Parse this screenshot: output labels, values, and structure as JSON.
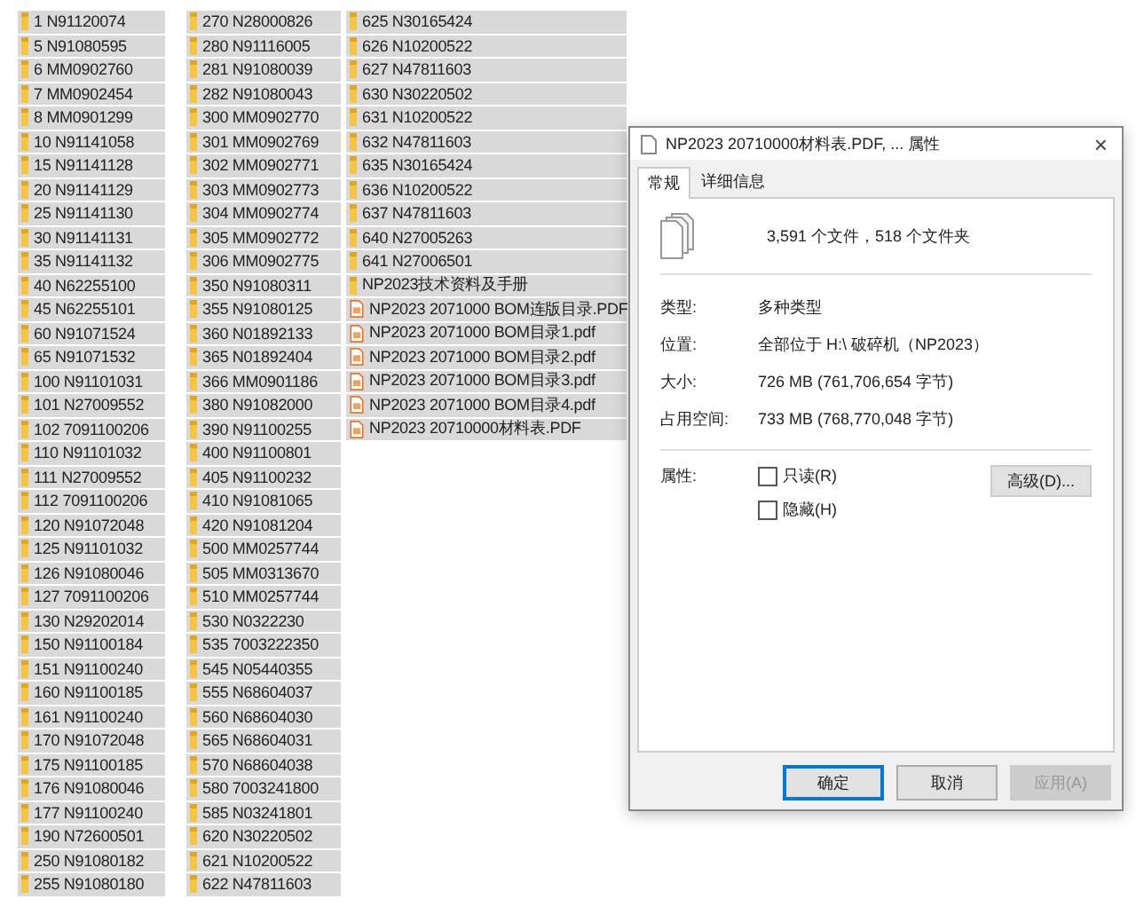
{
  "file_columns": [
    {
      "items": [
        {
          "name": "1 N91120074",
          "kind": "folder",
          "selected": true
        },
        {
          "name": "5 N91080595",
          "kind": "folder",
          "selected": true
        },
        {
          "name": "6 MM0902760",
          "kind": "folder",
          "selected": true
        },
        {
          "name": "7 MM0902454",
          "kind": "folder",
          "selected": true
        },
        {
          "name": "8 MM0901299",
          "kind": "folder",
          "selected": true
        },
        {
          "name": "10 N91141058",
          "kind": "folder",
          "selected": true
        },
        {
          "name": "15 N91141128",
          "kind": "folder",
          "selected": true
        },
        {
          "name": "20 N91141129",
          "kind": "folder",
          "selected": true
        },
        {
          "name": "25 N91141130",
          "kind": "folder",
          "selected": true
        },
        {
          "name": "30 N91141131",
          "kind": "folder",
          "selected": true
        },
        {
          "name": "35 N91141132",
          "kind": "folder",
          "selected": true
        },
        {
          "name": "40 N62255100",
          "kind": "folder",
          "selected": true
        },
        {
          "name": "45 N62255101",
          "kind": "folder",
          "selected": true
        },
        {
          "name": "60 N91071524",
          "kind": "folder",
          "selected": true
        },
        {
          "name": "65 N91071532",
          "kind": "folder",
          "selected": true
        },
        {
          "name": "100 N91101031",
          "kind": "folder",
          "selected": true
        },
        {
          "name": "101 N27009552",
          "kind": "folder",
          "selected": true
        },
        {
          "name": "102 7091100206",
          "kind": "folder",
          "selected": true
        },
        {
          "name": "110 N91101032",
          "kind": "folder",
          "selected": true
        },
        {
          "name": "111 N27009552",
          "kind": "folder",
          "selected": true
        },
        {
          "name": "112 7091100206",
          "kind": "folder",
          "selected": true
        },
        {
          "name": "120 N91072048",
          "kind": "folder",
          "selected": true
        },
        {
          "name": "125 N91101032",
          "kind": "folder",
          "selected": true
        },
        {
          "name": "126 N91080046",
          "kind": "folder",
          "selected": true
        },
        {
          "name": "127 7091100206",
          "kind": "folder",
          "selected": true
        },
        {
          "name": "130 N29202014",
          "kind": "folder",
          "selected": true
        },
        {
          "name": "150 N91100184",
          "kind": "folder",
          "selected": true
        },
        {
          "name": "151 N91100240",
          "kind": "folder",
          "selected": true
        },
        {
          "name": "160 N91100185",
          "kind": "folder",
          "selected": true
        },
        {
          "name": "161 N91100240",
          "kind": "folder",
          "selected": true
        },
        {
          "name": "170 N91072048",
          "kind": "folder",
          "selected": true
        },
        {
          "name": "175 N91100185",
          "kind": "folder",
          "selected": true
        },
        {
          "name": "176 N91080046",
          "kind": "folder",
          "selected": true
        },
        {
          "name": "177 N91100240",
          "kind": "folder",
          "selected": true
        },
        {
          "name": "190 N72600501",
          "kind": "folder",
          "selected": true
        },
        {
          "name": "250 N91080182",
          "kind": "folder",
          "selected": true
        },
        {
          "name": "255 N91080180",
          "kind": "folder",
          "selected": true
        }
      ]
    },
    {
      "items": [
        {
          "name": "270 N28000826",
          "kind": "folder",
          "selected": true
        },
        {
          "name": "280 N91116005",
          "kind": "folder",
          "selected": true
        },
        {
          "name": "281 N91080039",
          "kind": "folder",
          "selected": true
        },
        {
          "name": "282 N91080043",
          "kind": "folder",
          "selected": true
        },
        {
          "name": "300 MM0902770",
          "kind": "folder",
          "selected": true
        },
        {
          "name": "301 MM0902769",
          "kind": "folder",
          "selected": true
        },
        {
          "name": "302 MM0902771",
          "kind": "folder",
          "selected": true
        },
        {
          "name": "303 MM0902773",
          "kind": "folder",
          "selected": true
        },
        {
          "name": "304 MM0902774",
          "kind": "folder",
          "selected": true
        },
        {
          "name": "305 MM0902772",
          "kind": "folder",
          "selected": true
        },
        {
          "name": "306 MM0902775",
          "kind": "folder",
          "selected": true
        },
        {
          "name": "350 N91080311",
          "kind": "folder",
          "selected": true
        },
        {
          "name": "355 N91080125",
          "kind": "folder",
          "selected": true
        },
        {
          "name": "360 N01892133",
          "kind": "folder",
          "selected": true
        },
        {
          "name": "365 N01892404",
          "kind": "folder",
          "selected": true
        },
        {
          "name": "366 MM0901186",
          "kind": "folder",
          "selected": true
        },
        {
          "name": "380 N91082000",
          "kind": "folder",
          "selected": true
        },
        {
          "name": "390 N91100255",
          "kind": "folder",
          "selected": true
        },
        {
          "name": "400 N91100801",
          "kind": "folder",
          "selected": true
        },
        {
          "name": "405 N91100232",
          "kind": "folder",
          "selected": true
        },
        {
          "name": "410 N91081065",
          "kind": "folder",
          "selected": true
        },
        {
          "name": "420 N91081204",
          "kind": "folder",
          "selected": true
        },
        {
          "name": "500 MM0257744",
          "kind": "folder",
          "selected": true
        },
        {
          "name": "505 MM0313670",
          "kind": "folder",
          "selected": true
        },
        {
          "name": "510 MM0257744",
          "kind": "folder",
          "selected": true
        },
        {
          "name": "530 N0322230",
          "kind": "folder",
          "selected": true
        },
        {
          "name": "535 7003222350",
          "kind": "folder",
          "selected": true
        },
        {
          "name": "545 N05440355",
          "kind": "folder",
          "selected": true
        },
        {
          "name": "555 N68604037",
          "kind": "folder",
          "selected": true
        },
        {
          "name": "560 N68604030",
          "kind": "folder",
          "selected": true
        },
        {
          "name": "565 N68604031",
          "kind": "folder",
          "selected": true
        },
        {
          "name": "570 N68604038",
          "kind": "folder",
          "selected": true
        },
        {
          "name": "580 7003241800",
          "kind": "folder",
          "selected": true
        },
        {
          "name": "585 N03241801",
          "kind": "folder",
          "selected": true
        },
        {
          "name": "620 N30220502",
          "kind": "folder",
          "selected": true
        },
        {
          "name": "621 N10200522",
          "kind": "folder",
          "selected": true
        },
        {
          "name": "622 N47811603",
          "kind": "folder",
          "selected": true
        }
      ]
    },
    {
      "items": [
        {
          "name": "625 N30165424",
          "kind": "folder",
          "selected": true
        },
        {
          "name": "626 N10200522",
          "kind": "folder",
          "selected": true
        },
        {
          "name": "627 N47811603",
          "kind": "folder",
          "selected": true
        },
        {
          "name": "630 N30220502",
          "kind": "folder",
          "selected": true
        },
        {
          "name": "631 N10200522",
          "kind": "folder",
          "selected": true
        },
        {
          "name": "632 N47811603",
          "kind": "folder",
          "selected": true
        },
        {
          "name": "635 N30165424",
          "kind": "folder",
          "selected": true
        },
        {
          "name": "636 N10200522",
          "kind": "folder",
          "selected": true
        },
        {
          "name": "637 N47811603",
          "kind": "folder",
          "selected": true
        },
        {
          "name": "640 N27005263",
          "kind": "folder",
          "selected": true
        },
        {
          "name": "641 N27006501",
          "kind": "folder",
          "selected": true
        },
        {
          "name": "NP2023技术资料及手册",
          "kind": "folder",
          "selected": true
        },
        {
          "name": "NP2023 2071000 BOM连版目录.PDF",
          "kind": "pdf",
          "selected": true
        },
        {
          "name": "NP2023 2071000 BOM目录1.pdf",
          "kind": "pdf",
          "selected": true
        },
        {
          "name": "NP2023 2071000 BOM目录2.pdf",
          "kind": "pdf",
          "selected": true
        },
        {
          "name": "NP2023 2071000 BOM目录3.pdf",
          "kind": "pdf",
          "selected": true
        },
        {
          "name": "NP2023 2071000 BOM目录4.pdf",
          "kind": "pdf",
          "selected": true
        },
        {
          "name": "NP2023 20710000材料表.PDF",
          "kind": "pdf",
          "selected": true
        }
      ]
    }
  ],
  "dialog": {
    "title": "NP2023 20710000材料表.PDF, ... 属性",
    "close": "×",
    "tabs": [
      {
        "label": "常规",
        "selected": true
      },
      {
        "label": "详细信息",
        "selected": false
      }
    ],
    "summary": "3,591 个文件，518 个文件夹",
    "properties": [
      {
        "label": "类型:",
        "value": "多种类型"
      },
      {
        "label": "位置:",
        "value": "全部位于 H:\\ 破碎机（NP2023）"
      },
      {
        "label": "大小:",
        "value": "726 MB (761,706,654 字节)"
      },
      {
        "label": "占用空间:",
        "value": "733 MB (768,770,048 字节)"
      }
    ],
    "attributes": {
      "label": "属性:",
      "options": [
        {
          "label": "只读(R)",
          "checked": false
        },
        {
          "label": "隐藏(H)",
          "checked": false
        }
      ],
      "advanced_button": "高级(D)..."
    },
    "buttons": [
      {
        "label": "确定",
        "default": true,
        "disabled": false
      },
      {
        "label": "取消",
        "default": false,
        "disabled": false
      },
      {
        "label": "应用(A)",
        "default": false,
        "disabled": true
      }
    ]
  }
}
